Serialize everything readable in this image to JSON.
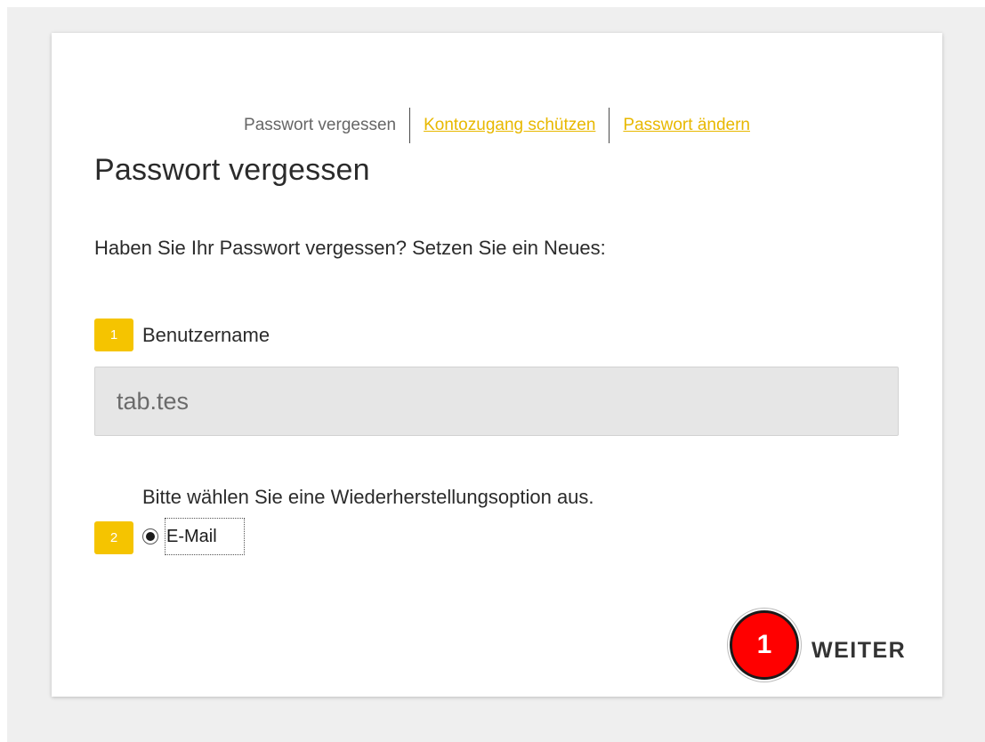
{
  "nav": {
    "steps": [
      {
        "label": "Passwort vergessen"
      },
      {
        "label": "Kontozugang schützen"
      },
      {
        "label": "Passwort ändern"
      }
    ]
  },
  "title": "Passwort vergessen",
  "intro": "Haben Sie Ihr Passwort vergessen? Setzen Sie ein Neues:",
  "step1": {
    "badge": "1",
    "label": "Benutzername",
    "username_value": "tab.tes"
  },
  "step2": {
    "badge": "2",
    "prompt": "Bitte wählen Sie eine Wiederherstellungsoption aus.",
    "option_label": "E-Mail",
    "option_selected": true
  },
  "annotation": {
    "number": "1"
  },
  "actions": {
    "next_label": "WEITER"
  },
  "colors": {
    "accent": "#f5c400",
    "link": "#e8b800",
    "annotation": "#ff0000",
    "background": "#efefef"
  }
}
